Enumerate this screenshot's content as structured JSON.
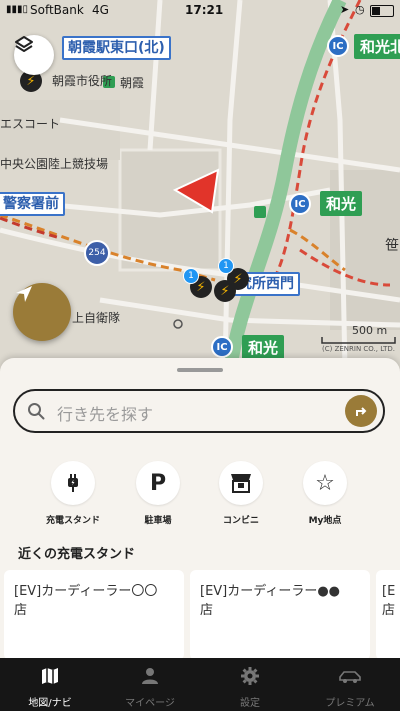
{
  "status": {
    "carrier": "SoftBank",
    "network": "4G",
    "time": "17:21"
  },
  "map": {
    "labels": {
      "asaka_station": "朝霞駅東口(北)",
      "asaka_city_hall": "朝霞市役所",
      "asaka": "朝霞",
      "escort": "エスコート",
      "athletics": "中央公園陸上競技場",
      "police": "警察署前",
      "route_254": "254",
      "research_west": "究所西門",
      "self_defense": "上自衛隊",
      "wako_ic_top": "和光北",
      "wako_mid": "和光",
      "wako_ic_bottom": "和光",
      "kasa": "笹",
      "scale": "500 m",
      "copyright": "(C) ZENRIN CO., LTD.",
      "ic": "IC"
    },
    "pin_badges": [
      "1",
      "1"
    ]
  },
  "sheet": {
    "search_placeholder": "行き先を探す",
    "quick_actions": [
      {
        "icon": "charging-plug-icon",
        "label": "充電スタンド"
      },
      {
        "icon": "parking-icon",
        "label": "駐車場",
        "glyph": "P"
      },
      {
        "icon": "convenience-store-icon",
        "label": "コンビニ"
      },
      {
        "icon": "star-icon",
        "label": "My地点",
        "glyph": "☆"
      }
    ],
    "nearby_title": "近くの充電スタンド",
    "cards": [
      {
        "line1": "[EV]カーディーラー〇〇",
        "line2": "店"
      },
      {
        "line1": "[EV]カーディーラー●●",
        "line2": "店"
      },
      {
        "line1": "[E",
        "line2": "店"
      }
    ]
  },
  "tabs": [
    {
      "label": "地図/ナビ",
      "active": true
    },
    {
      "label": "マイページ",
      "active": false
    },
    {
      "label": "設定",
      "active": false
    },
    {
      "label": "プレミアム",
      "active": false
    }
  ],
  "colors": {
    "accent": "#9a7b38",
    "map_label_blue": "#2d5fae",
    "expressway_green": "#2f9e53",
    "tab_bg": "#161616"
  }
}
